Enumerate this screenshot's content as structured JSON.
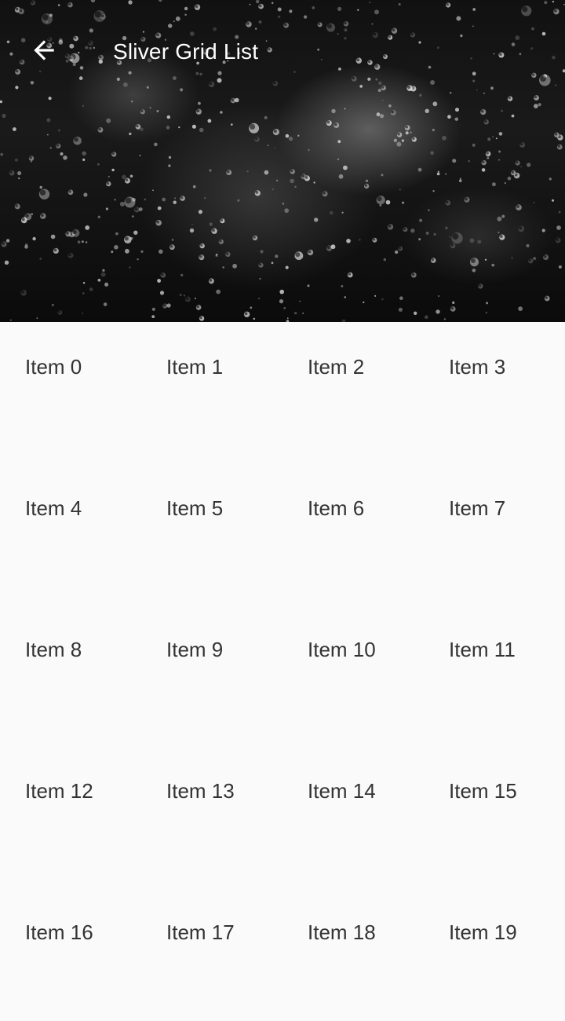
{
  "app_bar": {
    "title": "Sliver Grid List",
    "back_icon": "arrow-left-icon",
    "icon_color": "#ffffff",
    "header_image": "rain-drops-on-glass"
  },
  "grid": {
    "items": [
      "Item 0",
      "Item 1",
      "Item 2",
      "Item 3",
      "Item 4",
      "Item 5",
      "Item 6",
      "Item 7",
      "Item 8",
      "Item 9",
      "Item 10",
      "Item 11",
      "Item 12",
      "Item 13",
      "Item 14",
      "Item 15",
      "Item 16",
      "Item 17",
      "Item 18",
      "Item 19"
    ]
  },
  "colors": {
    "background": "#fafafa",
    "text": "#333333",
    "title": "#ffffff"
  }
}
